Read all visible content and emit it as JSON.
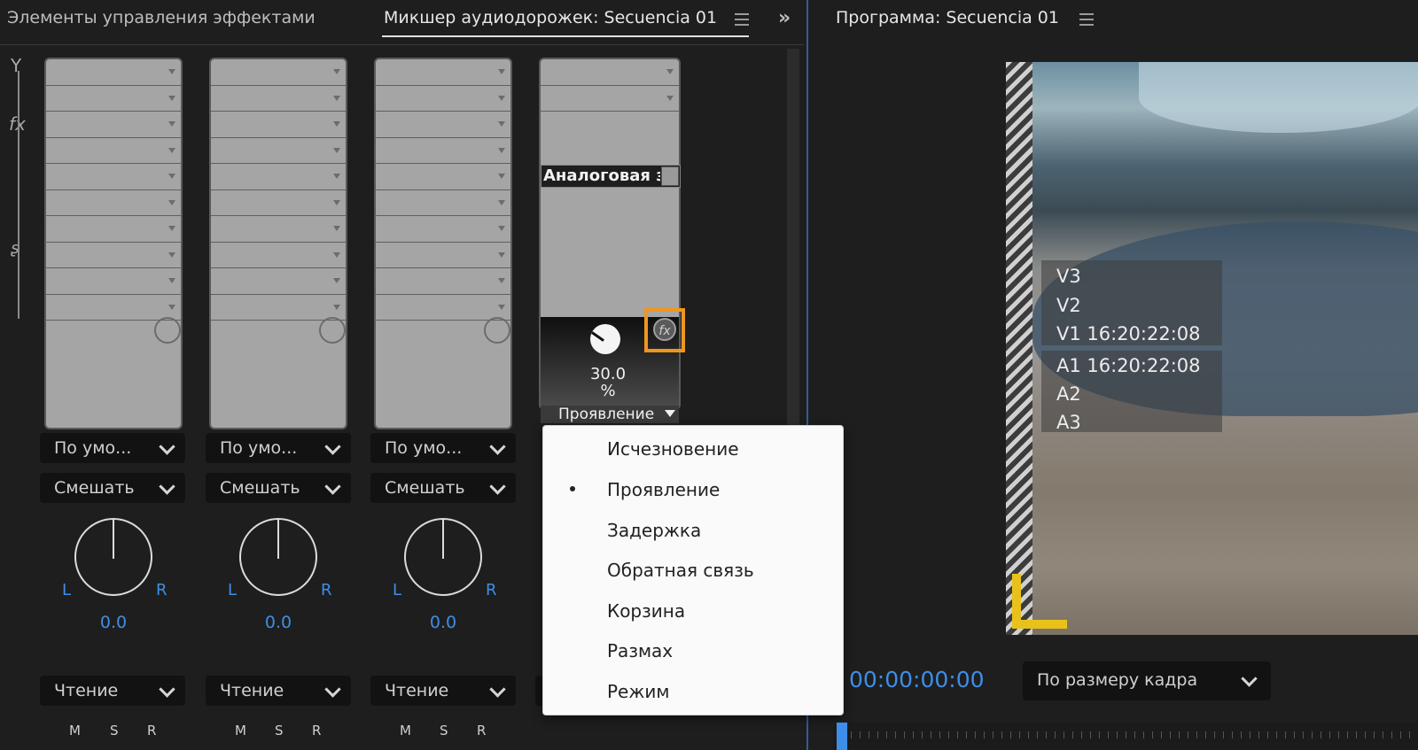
{
  "tabs": {
    "effects_controls": "Элементы управления эффектами",
    "audio_mixer": "Микшер аудиодорожек: Secuencia 01",
    "program": "Программа: Secuencia 01"
  },
  "mixer": {
    "channels": [
      {
        "route": "По умо...",
        "blend": "Смешать",
        "pan_value": "0.0",
        "automation": "Чтение"
      },
      {
        "route": "По умо...",
        "blend": "Смешать",
        "pan_value": "0.0",
        "automation": "Чтение"
      },
      {
        "route": "По умо...",
        "blend": "Смешать",
        "pan_value": "0.0",
        "automation": "Чтение"
      }
    ],
    "pan_left": "L",
    "pan_right": "R",
    "msr": [
      "M",
      "S",
      "R"
    ],
    "effect_channel": {
      "effect_name": "Аналоговая з",
      "param_value": "30.0",
      "param_unit": "%",
      "param_name": "Проявление"
    }
  },
  "popup_menu": {
    "items": [
      "Исчезновение",
      "Проявление",
      "Задержка",
      "Обратная связь",
      "Корзина",
      "Размах",
      "Режим"
    ],
    "selected_index": 1
  },
  "program": {
    "overlay_video": [
      "V3",
      "V2",
      "V1 16:20:22:08"
    ],
    "overlay_audio": [
      "A1 16:20:22:08",
      "A2",
      "A3"
    ],
    "timecode": "00:00:00:00",
    "fit": "По размеру кадра"
  },
  "colors": {
    "accent_blue": "#3d8ee8",
    "highlight_orange": "#f0961e",
    "safe_margin_yellow": "#e8c21a"
  }
}
